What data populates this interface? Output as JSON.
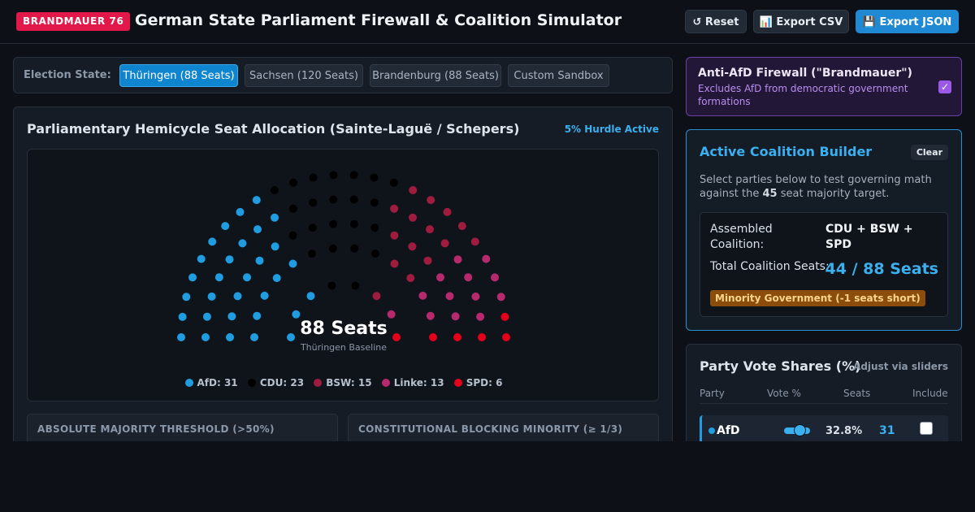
{
  "header": {
    "logo": "BRANDMAUER 76",
    "title": "German State Parliament Firewall & Coalition Simulator",
    "buttons": {
      "reset": "↺ Reset",
      "export_csv": "📊 Export CSV",
      "export_json": "💾 Export JSON"
    }
  },
  "state_selector": {
    "label": "Election State:",
    "options": [
      "Thüringen (88 Seats)",
      "Sachsen (120 Seats)",
      "Brandenburg (88 Seats)",
      "Custom Sandbox"
    ],
    "selected": "Thüringen (88 Seats)"
  },
  "hemicycle": {
    "title": "Parliamentary Hemicycle Seat Allocation (Sainte-Laguë / Schepers)",
    "hurdle_badge": "5% Hurdle Active",
    "total_label": "88 Seats",
    "subtitle": "Thüringen Baseline",
    "parties": [
      {
        "name": "AfD",
        "seats": 31,
        "color": "#1f9de0",
        "legend": "AfD: 31"
      },
      {
        "name": "CDU",
        "seats": 23,
        "color": "#000000",
        "legend": "CDU: 23"
      },
      {
        "name": "BSW",
        "seats": 15,
        "color": "#a01c3f",
        "legend": "BSW: 15"
      },
      {
        "name": "Linke",
        "seats": 13,
        "color": "#b62a6d",
        "legend": "Linke: 13"
      },
      {
        "name": "SPD",
        "seats": 6,
        "color": "#e3001b",
        "legend": "SPD: 6"
      }
    ]
  },
  "thresholds": {
    "majority_label": "ABSOLUTE MAJORITY THRESHOLD (>50%)",
    "blocking_label": "CONSTITUTIONAL BLOCKING MINORITY (≥ 1/3)"
  },
  "firewall": {
    "title": "Anti-AfD Firewall (\"Brandmauer\")",
    "description": "Excludes AfD from democratic government formations",
    "checked": true,
    "check_glyph": "✓"
  },
  "coalition_builder": {
    "title": "Active Coalition Builder",
    "clear_label": "Clear",
    "hint_pre": "Select parties below to test governing math against the ",
    "hint_bold": "45",
    "hint_post": " seat majority target.",
    "assembled_label": "Assembled Coalition:",
    "assembled_value": "CDU + BSW + SPD",
    "total_label": "Total Coalition Seats:",
    "total_value": "44 / 88 Seats",
    "status": "Minority Government (-1 seats short)"
  },
  "vote_shares": {
    "title": "Party Vote Shares (%)",
    "adjust_hint": "Adjust via sliders",
    "columns": [
      "Party",
      "Vote %",
      "Seats",
      "Include"
    ],
    "rows": [
      {
        "party": "AfD",
        "vote_pct": "32.8%",
        "vote_value": 32.8,
        "seats": "31",
        "included": false,
        "color": "#1f9de0"
      }
    ]
  }
}
